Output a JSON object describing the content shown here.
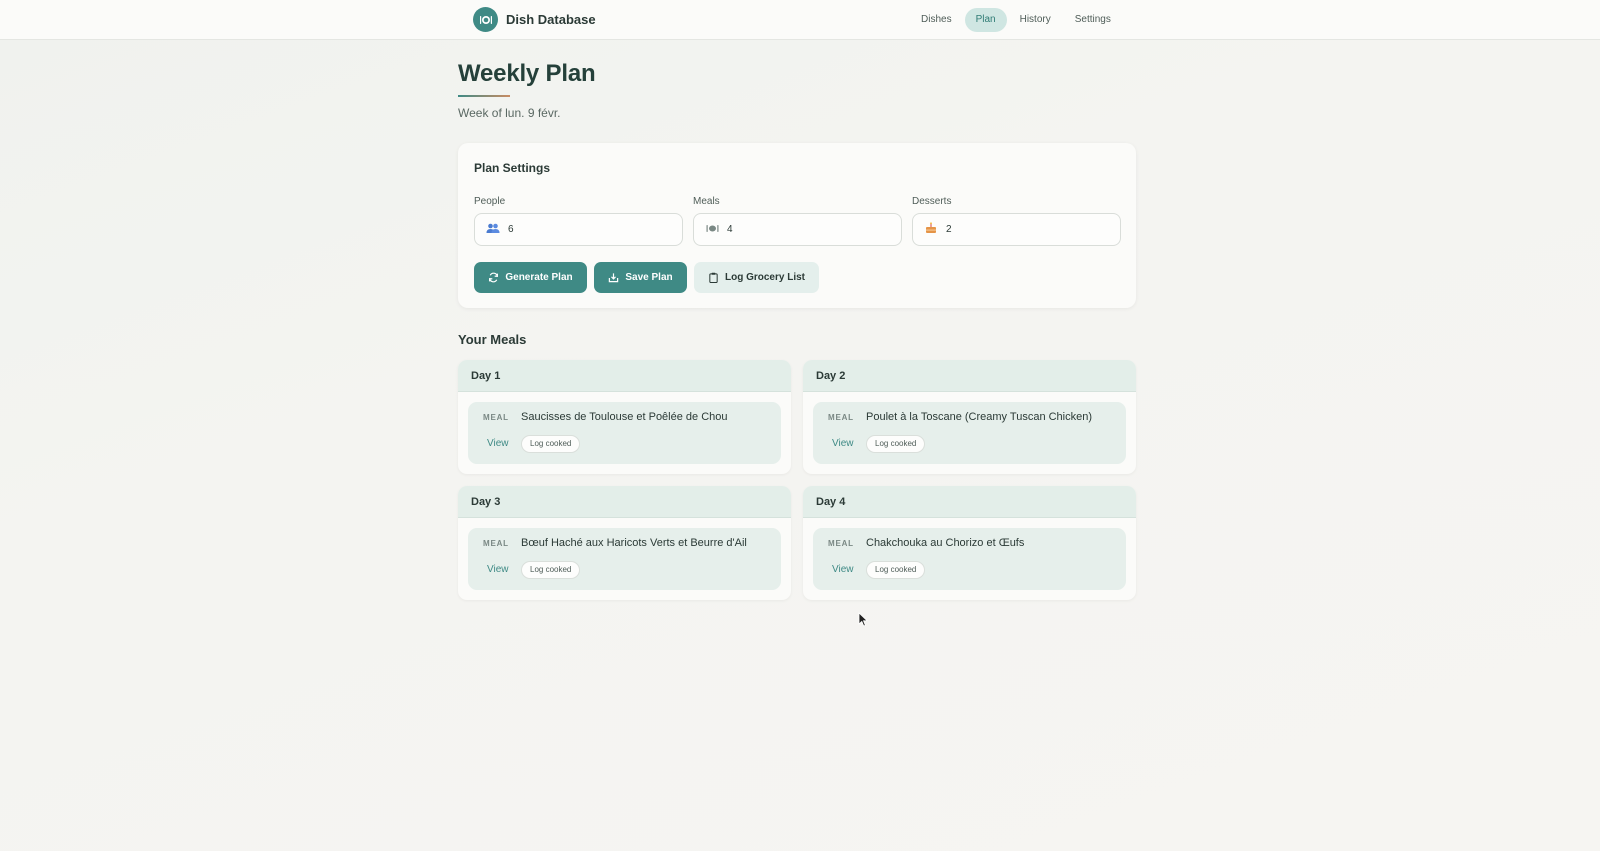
{
  "app": {
    "name": "Dish Database",
    "logo_icon": "plate-utensils-icon"
  },
  "nav": {
    "items": [
      {
        "label": "Dishes",
        "active": false
      },
      {
        "label": "Plan",
        "active": true
      },
      {
        "label": "History",
        "active": false
      },
      {
        "label": "Settings",
        "active": false
      }
    ]
  },
  "header": {
    "title": "Weekly Plan",
    "subtitle": "Week of lun. 9 févr."
  },
  "settings": {
    "title": "Plan Settings",
    "fields": [
      {
        "label": "People",
        "icon": "people-icon",
        "value": "6"
      },
      {
        "label": "Meals",
        "icon": "meal-icon",
        "value": "4"
      },
      {
        "label": "Desserts",
        "icon": "cake-icon",
        "value": "2"
      }
    ],
    "buttons": {
      "generate": "Generate Plan",
      "save": "Save Plan",
      "grocery": "Log Grocery List"
    }
  },
  "meals": {
    "title": "Your Meals",
    "days": [
      {
        "day": "Day 1",
        "tag": "MEAL",
        "name": "Saucisses de Toulouse et Poêlée de Chou",
        "view": "View",
        "log": "Log cooked"
      },
      {
        "day": "Day 2",
        "tag": "MEAL",
        "name": "Poulet à la Toscane (Creamy Tuscan Chicken)",
        "view": "View",
        "log": "Log cooked"
      },
      {
        "day": "Day 3",
        "tag": "MEAL",
        "name": "Bœuf Haché aux Haricots Verts et Beurre d'Ail",
        "view": "View",
        "log": "Log cooked"
      },
      {
        "day": "Day 4",
        "tag": "MEAL",
        "name": "Chakchouka au Chorizo et Œufs",
        "view": "View",
        "log": "Log cooked"
      }
    ]
  },
  "colors": {
    "accent": "#3f8a85",
    "accent_light": "#cfe6e2",
    "background": "#f4f4f1",
    "card": "#fbfbf9"
  }
}
